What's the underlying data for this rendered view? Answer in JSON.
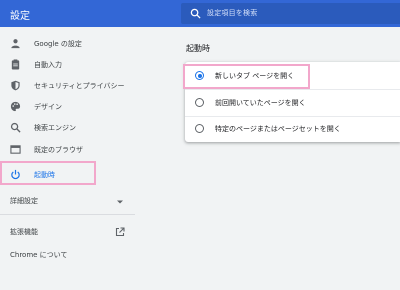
{
  "header": {
    "title": "設定",
    "search_placeholder": "設定項目を検索"
  },
  "sidebar": {
    "items": [
      {
        "label": "Google の設定",
        "icon": "person-icon"
      },
      {
        "label": "自動入力",
        "icon": "clipboard-icon"
      },
      {
        "label": "セキュリティとプライバシー",
        "icon": "shield-icon"
      },
      {
        "label": "デザイン",
        "icon": "palette-icon"
      },
      {
        "label": "検索エンジン",
        "icon": "search-icon"
      },
      {
        "label": "既定のブラウザ",
        "icon": "browser-icon"
      },
      {
        "label": "起動時",
        "icon": "power-icon",
        "active": true
      }
    ],
    "advanced_label": "詳細設定",
    "extensions_label": "拡張機能",
    "about_label": "Chrome について"
  },
  "main": {
    "section_title": "起動時",
    "options": [
      {
        "label": "新しいタブ ページを開く",
        "checked": true
      },
      {
        "label": "前回開いていたページを開く",
        "checked": false
      },
      {
        "label": "特定のページまたはページセットを開く",
        "checked": false
      }
    ]
  },
  "colors": {
    "header_bg": "#3367d6",
    "accent": "#1a73e8",
    "highlight": "#f2a7cb"
  }
}
